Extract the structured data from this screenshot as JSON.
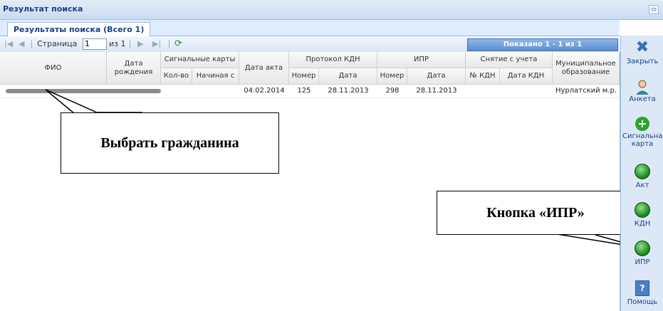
{
  "window": {
    "title": "Результат поиска",
    "restore_icon": "restore-icon"
  },
  "tab": {
    "label": "Результаты поиска (Всего 1)"
  },
  "paging": {
    "page_label": "Страница",
    "page_value": "1",
    "of_label": "из 1",
    "showing": "Показано 1 - 1 из 1"
  },
  "headers": {
    "fio": "ФИО",
    "birth": "Дата рождения",
    "signal_cards": "Сигнальные карты",
    "signal_count": "Кол-во",
    "signal_start": "Начиная с",
    "act_date": "Дата акта",
    "kdn_protocol": "Протокол КДН",
    "kdn_number": "Номер",
    "kdn_date": "Дата",
    "ipr": "ИПР",
    "ipr_number": "Номер",
    "ipr_date": "Дата",
    "removal": "Снятие с учета",
    "removal_kdn_no": "№ КДН",
    "removal_kdn_date": "Дата КДН",
    "municipal": "Муниципальное образование"
  },
  "rows": [
    {
      "fio": "",
      "birth": "",
      "signal_count": "",
      "signal_start": "",
      "act_date": "04.02.2014",
      "kdn_number": "125",
      "kdn_date": "28.11.2013",
      "ipr_number": "298",
      "ipr_date": "28.11.2013",
      "removal_kdn_no": "",
      "removal_kdn_date": "",
      "municipal": "Нурлатский м.р."
    }
  ],
  "callouts": {
    "select_citizen": "Выбрать гражданина",
    "ipr_button": "Кнопка «ИПР»"
  },
  "sidebar": {
    "close": "Закрыть",
    "anketa": "Анкета",
    "signal_card": "Сигнальная карта",
    "act": "Акт",
    "kdn": "КДН",
    "ipr": "ИПР",
    "help": "Помощь"
  },
  "colors": {
    "accent": "#15428b",
    "header_bg": "#dfe8f6",
    "status_green": "#1d8a1d"
  }
}
